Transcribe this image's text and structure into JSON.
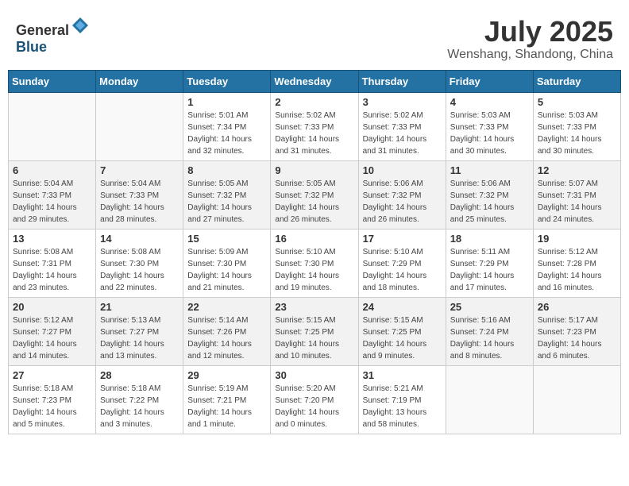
{
  "header": {
    "logo": {
      "general": "General",
      "blue": "Blue"
    },
    "title": "July 2025",
    "location": "Wenshang, Shandong, China"
  },
  "calendar": {
    "weekdays": [
      "Sunday",
      "Monday",
      "Tuesday",
      "Wednesday",
      "Thursday",
      "Friday",
      "Saturday"
    ],
    "weeks": [
      [
        {
          "day": "",
          "sunrise": "",
          "sunset": "",
          "daylight": ""
        },
        {
          "day": "",
          "sunrise": "",
          "sunset": "",
          "daylight": ""
        },
        {
          "day": "1",
          "sunrise": "Sunrise: 5:01 AM",
          "sunset": "Sunset: 7:34 PM",
          "daylight": "Daylight: 14 hours and 32 minutes."
        },
        {
          "day": "2",
          "sunrise": "Sunrise: 5:02 AM",
          "sunset": "Sunset: 7:33 PM",
          "daylight": "Daylight: 14 hours and 31 minutes."
        },
        {
          "day": "3",
          "sunrise": "Sunrise: 5:02 AM",
          "sunset": "Sunset: 7:33 PM",
          "daylight": "Daylight: 14 hours and 31 minutes."
        },
        {
          "day": "4",
          "sunrise": "Sunrise: 5:03 AM",
          "sunset": "Sunset: 7:33 PM",
          "daylight": "Daylight: 14 hours and 30 minutes."
        },
        {
          "day": "5",
          "sunrise": "Sunrise: 5:03 AM",
          "sunset": "Sunset: 7:33 PM",
          "daylight": "Daylight: 14 hours and 30 minutes."
        }
      ],
      [
        {
          "day": "6",
          "sunrise": "Sunrise: 5:04 AM",
          "sunset": "Sunset: 7:33 PM",
          "daylight": "Daylight: 14 hours and 29 minutes."
        },
        {
          "day": "7",
          "sunrise": "Sunrise: 5:04 AM",
          "sunset": "Sunset: 7:33 PM",
          "daylight": "Daylight: 14 hours and 28 minutes."
        },
        {
          "day": "8",
          "sunrise": "Sunrise: 5:05 AM",
          "sunset": "Sunset: 7:32 PM",
          "daylight": "Daylight: 14 hours and 27 minutes."
        },
        {
          "day": "9",
          "sunrise": "Sunrise: 5:05 AM",
          "sunset": "Sunset: 7:32 PM",
          "daylight": "Daylight: 14 hours and 26 minutes."
        },
        {
          "day": "10",
          "sunrise": "Sunrise: 5:06 AM",
          "sunset": "Sunset: 7:32 PM",
          "daylight": "Daylight: 14 hours and 26 minutes."
        },
        {
          "day": "11",
          "sunrise": "Sunrise: 5:06 AM",
          "sunset": "Sunset: 7:32 PM",
          "daylight": "Daylight: 14 hours and 25 minutes."
        },
        {
          "day": "12",
          "sunrise": "Sunrise: 5:07 AM",
          "sunset": "Sunset: 7:31 PM",
          "daylight": "Daylight: 14 hours and 24 minutes."
        }
      ],
      [
        {
          "day": "13",
          "sunrise": "Sunrise: 5:08 AM",
          "sunset": "Sunset: 7:31 PM",
          "daylight": "Daylight: 14 hours and 23 minutes."
        },
        {
          "day": "14",
          "sunrise": "Sunrise: 5:08 AM",
          "sunset": "Sunset: 7:30 PM",
          "daylight": "Daylight: 14 hours and 22 minutes."
        },
        {
          "day": "15",
          "sunrise": "Sunrise: 5:09 AM",
          "sunset": "Sunset: 7:30 PM",
          "daylight": "Daylight: 14 hours and 21 minutes."
        },
        {
          "day": "16",
          "sunrise": "Sunrise: 5:10 AM",
          "sunset": "Sunset: 7:30 PM",
          "daylight": "Daylight: 14 hours and 19 minutes."
        },
        {
          "day": "17",
          "sunrise": "Sunrise: 5:10 AM",
          "sunset": "Sunset: 7:29 PM",
          "daylight": "Daylight: 14 hours and 18 minutes."
        },
        {
          "day": "18",
          "sunrise": "Sunrise: 5:11 AM",
          "sunset": "Sunset: 7:29 PM",
          "daylight": "Daylight: 14 hours and 17 minutes."
        },
        {
          "day": "19",
          "sunrise": "Sunrise: 5:12 AM",
          "sunset": "Sunset: 7:28 PM",
          "daylight": "Daylight: 14 hours and 16 minutes."
        }
      ],
      [
        {
          "day": "20",
          "sunrise": "Sunrise: 5:12 AM",
          "sunset": "Sunset: 7:27 PM",
          "daylight": "Daylight: 14 hours and 14 minutes."
        },
        {
          "day": "21",
          "sunrise": "Sunrise: 5:13 AM",
          "sunset": "Sunset: 7:27 PM",
          "daylight": "Daylight: 14 hours and 13 minutes."
        },
        {
          "day": "22",
          "sunrise": "Sunrise: 5:14 AM",
          "sunset": "Sunset: 7:26 PM",
          "daylight": "Daylight: 14 hours and 12 minutes."
        },
        {
          "day": "23",
          "sunrise": "Sunrise: 5:15 AM",
          "sunset": "Sunset: 7:25 PM",
          "daylight": "Daylight: 14 hours and 10 minutes."
        },
        {
          "day": "24",
          "sunrise": "Sunrise: 5:15 AM",
          "sunset": "Sunset: 7:25 PM",
          "daylight": "Daylight: 14 hours and 9 minutes."
        },
        {
          "day": "25",
          "sunrise": "Sunrise: 5:16 AM",
          "sunset": "Sunset: 7:24 PM",
          "daylight": "Daylight: 14 hours and 8 minutes."
        },
        {
          "day": "26",
          "sunrise": "Sunrise: 5:17 AM",
          "sunset": "Sunset: 7:23 PM",
          "daylight": "Daylight: 14 hours and 6 minutes."
        }
      ],
      [
        {
          "day": "27",
          "sunrise": "Sunrise: 5:18 AM",
          "sunset": "Sunset: 7:23 PM",
          "daylight": "Daylight: 14 hours and 5 minutes."
        },
        {
          "day": "28",
          "sunrise": "Sunrise: 5:18 AM",
          "sunset": "Sunset: 7:22 PM",
          "daylight": "Daylight: 14 hours and 3 minutes."
        },
        {
          "day": "29",
          "sunrise": "Sunrise: 5:19 AM",
          "sunset": "Sunset: 7:21 PM",
          "daylight": "Daylight: 14 hours and 1 minute."
        },
        {
          "day": "30",
          "sunrise": "Sunrise: 5:20 AM",
          "sunset": "Sunset: 7:20 PM",
          "daylight": "Daylight: 14 hours and 0 minutes."
        },
        {
          "day": "31",
          "sunrise": "Sunrise: 5:21 AM",
          "sunset": "Sunset: 7:19 PM",
          "daylight": "Daylight: 13 hours and 58 minutes."
        },
        {
          "day": "",
          "sunrise": "",
          "sunset": "",
          "daylight": ""
        },
        {
          "day": "",
          "sunrise": "",
          "sunset": "",
          "daylight": ""
        }
      ]
    ]
  }
}
